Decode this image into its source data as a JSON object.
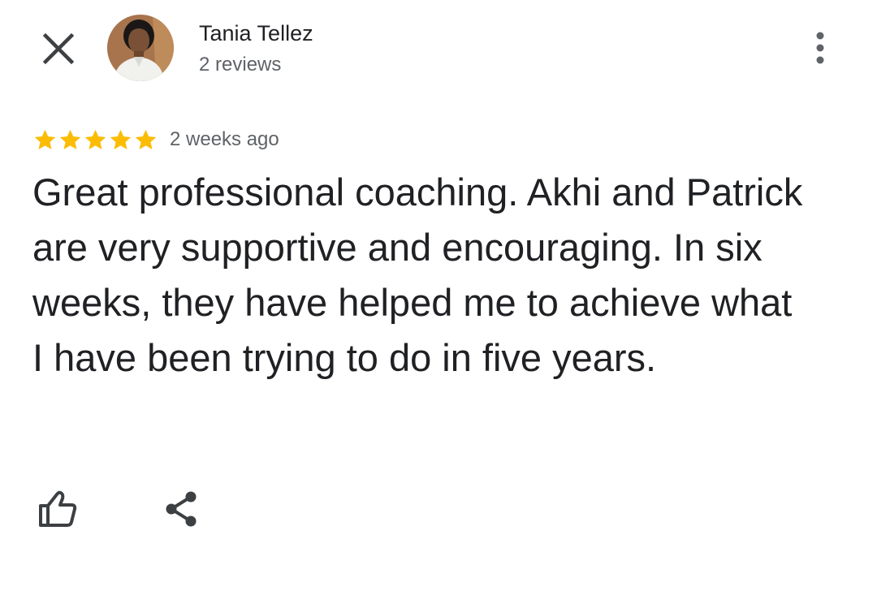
{
  "toolbar": {
    "close_icon": "close-icon",
    "more_icon": "more-vert-icon"
  },
  "reviewer": {
    "name": "Tania Tellez",
    "review_count": "2 reviews",
    "avatar": "profile-photo"
  },
  "review": {
    "rating": 5,
    "rating_max": 5,
    "star_color": "#fbbc04",
    "date": "2 weeks ago",
    "text": "Great professional coaching. Akhi and Patrick are very supportive and encouraging. In six weeks, they have helped me to achieve what I have been trying to do in five years."
  },
  "actions": {
    "like_icon": "thumb-up-icon",
    "share_icon": "share-icon"
  },
  "colors": {
    "primary_text": "#202124",
    "secondary_text": "#5f6368",
    "icon": "#3c4043"
  }
}
